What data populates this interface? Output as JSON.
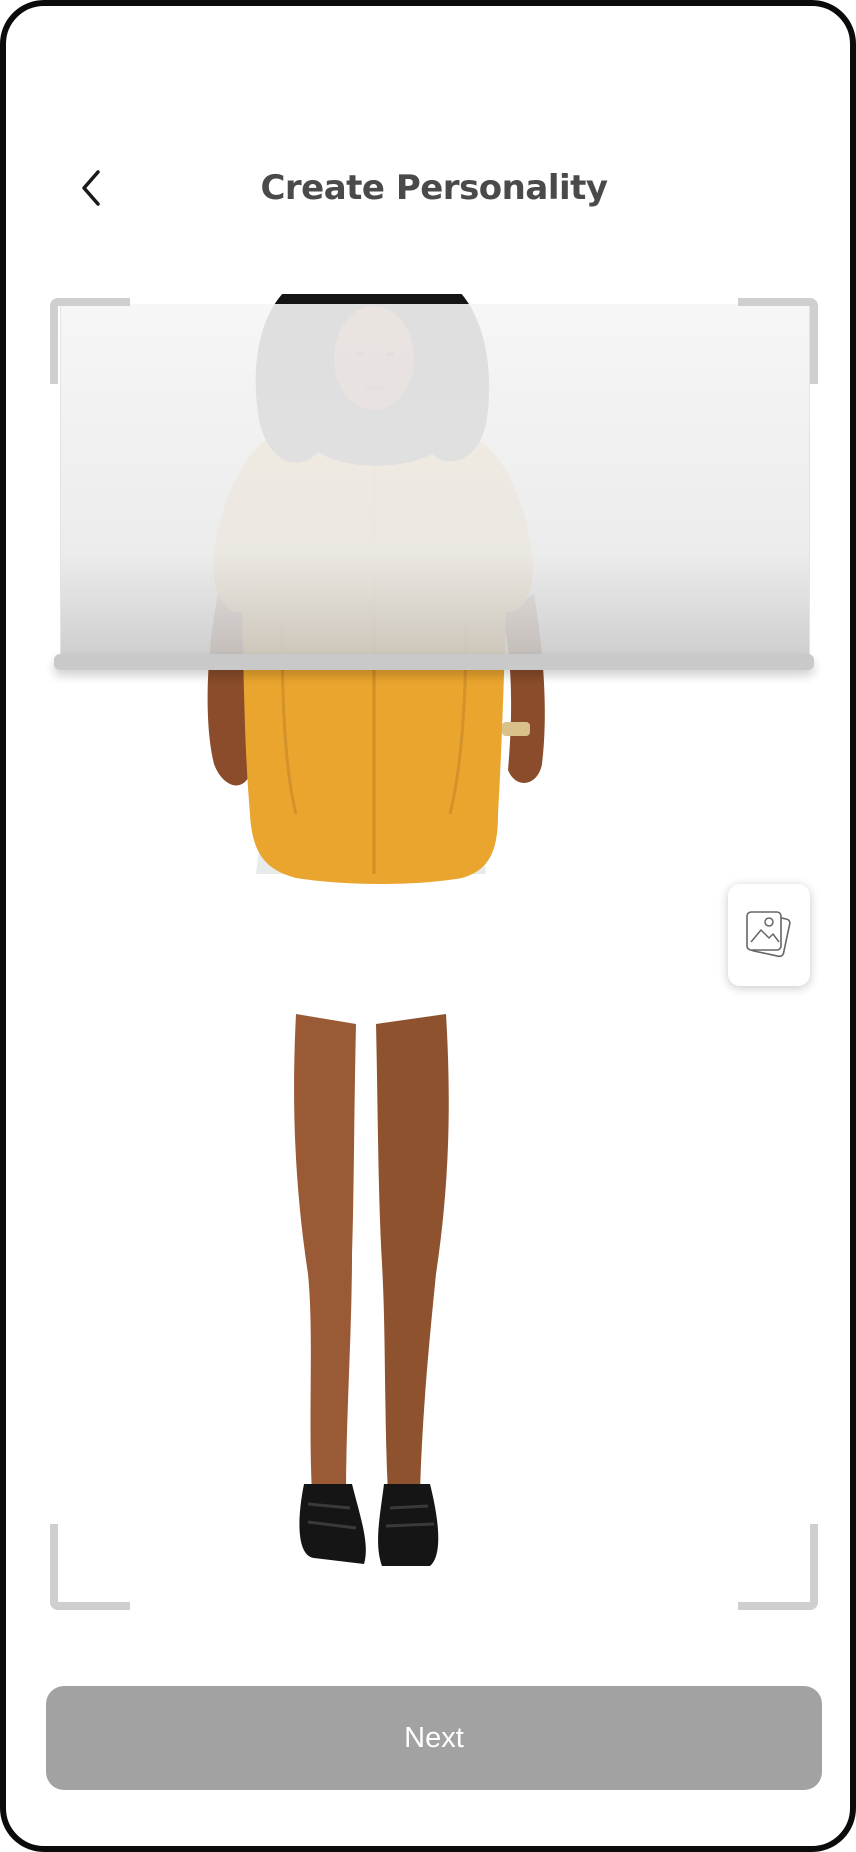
{
  "header": {
    "title": "Create Personality",
    "back_icon": "chevron-left-icon"
  },
  "camera": {
    "gallery_icon": "gallery-images-icon"
  },
  "footer": {
    "next_label": "Next"
  },
  "colors": {
    "title": "#4a4a4a",
    "button_bg": "#a2a2a2",
    "button_text": "#ffffff",
    "frame": "#0b0b0b",
    "corner_bracket": "#cfcfcf",
    "shirt": "#e9a52e"
  }
}
